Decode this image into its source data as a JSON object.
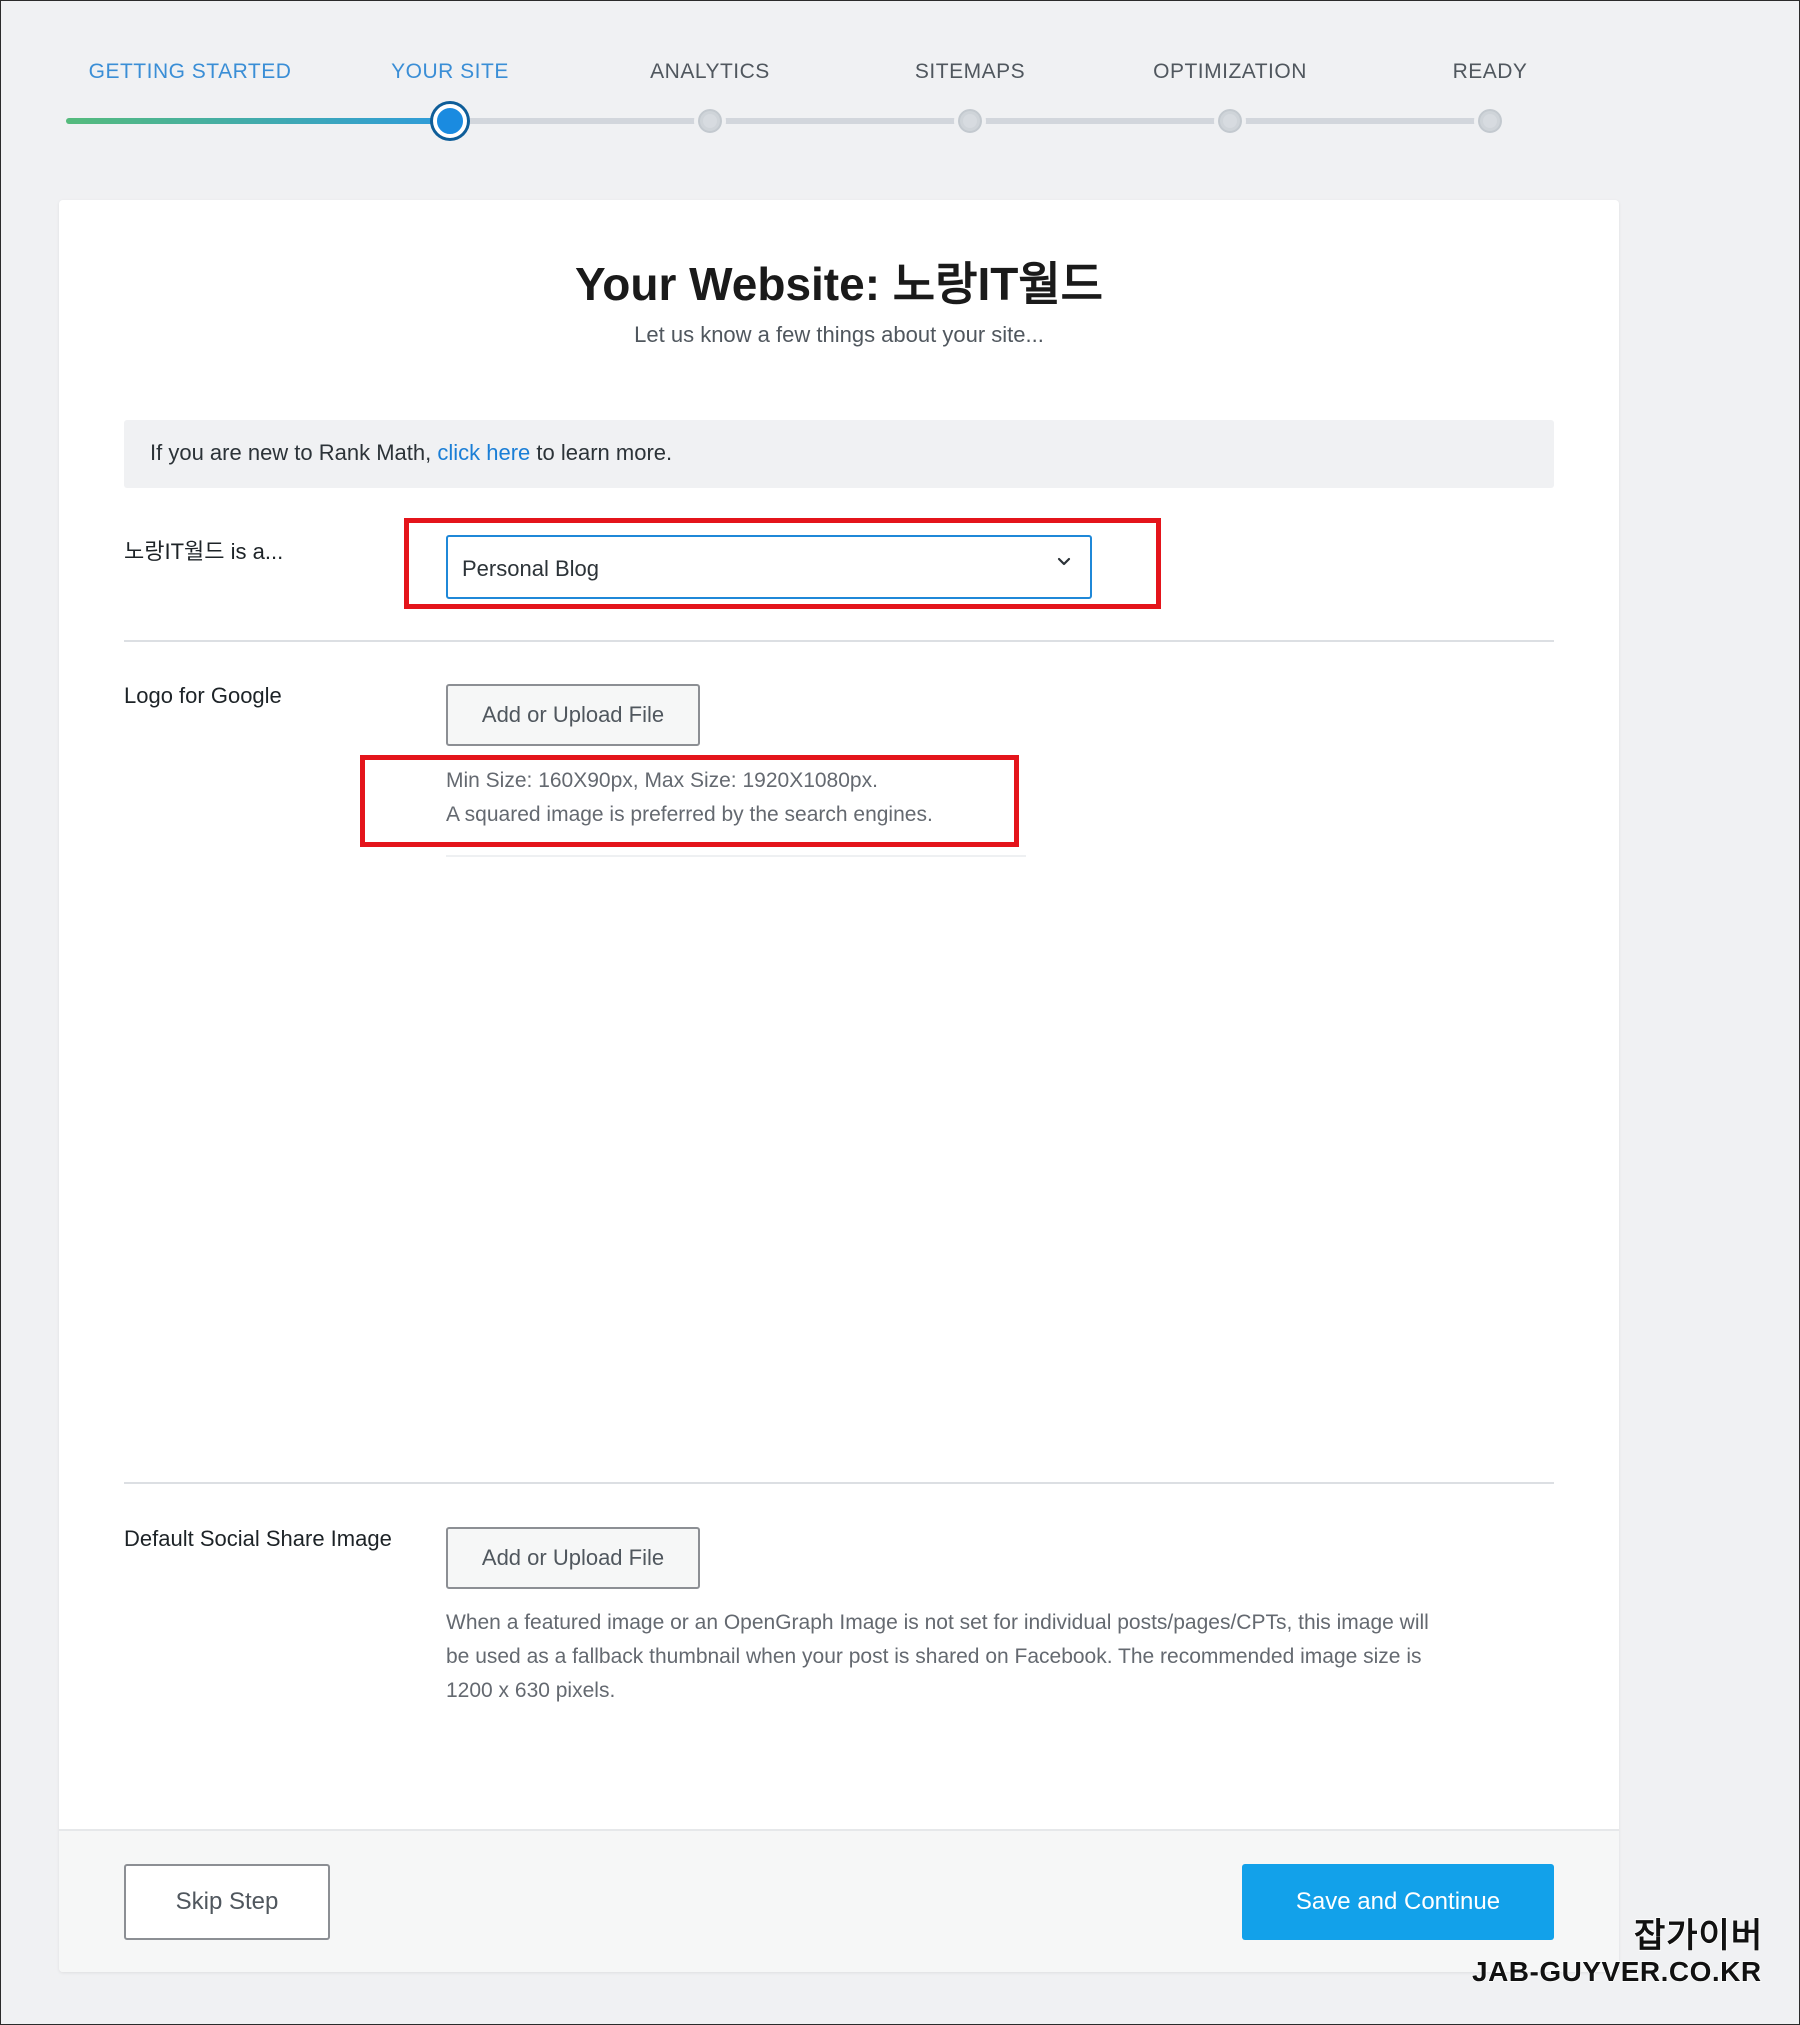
{
  "stepper": {
    "steps": [
      {
        "label": "GETTING STARTED",
        "state": "done"
      },
      {
        "label": "YOUR SITE",
        "state": "active"
      },
      {
        "label": "ANALYTICS",
        "state": "pending"
      },
      {
        "label": "SITEMAPS",
        "state": "pending"
      },
      {
        "label": "OPTIMIZATION",
        "state": "pending"
      },
      {
        "label": "READY",
        "state": "pending"
      }
    ],
    "progress_fraction": 0.2
  },
  "header": {
    "title": "Your Website: 노랑IT월드",
    "subtitle": "Let us know a few things about your site..."
  },
  "notice": {
    "prefix": "If you are new to Rank Math, ",
    "link": "click here",
    "suffix": " to learn more."
  },
  "site_type": {
    "label": "노랑IT월드 is a...",
    "value": "Personal Blog",
    "chevron_icon": "chevron-down-icon"
  },
  "logo": {
    "label": "Logo for Google",
    "button": "Add or Upload File",
    "help_line1": "Min Size: 160X90px, Max Size: 1920X1080px.",
    "help_line2": "A squared image is preferred by the search engines."
  },
  "social": {
    "label": "Default Social Share Image",
    "button": "Add or Upload File",
    "help_line1": "When a featured image or an OpenGraph Image is not set for individual posts/pages/CPTs, this image will",
    "help_line2": "be used as a fallback thumbnail when your post is shared on Facebook. The recommended image size is",
    "help_line3": "1200 x 630 pixels."
  },
  "footer": {
    "skip": "Skip Step",
    "save": "Save and Continue"
  },
  "watermark": {
    "line1": "잡가이버",
    "line2": "JAB-GUYVER.CO.KR"
  },
  "colors": {
    "accent": "#1a8be0",
    "primary_button": "#12a1ea",
    "highlight_box": "#e4141b",
    "progress_start": "#55bb7c",
    "link": "#1a7ed6"
  }
}
